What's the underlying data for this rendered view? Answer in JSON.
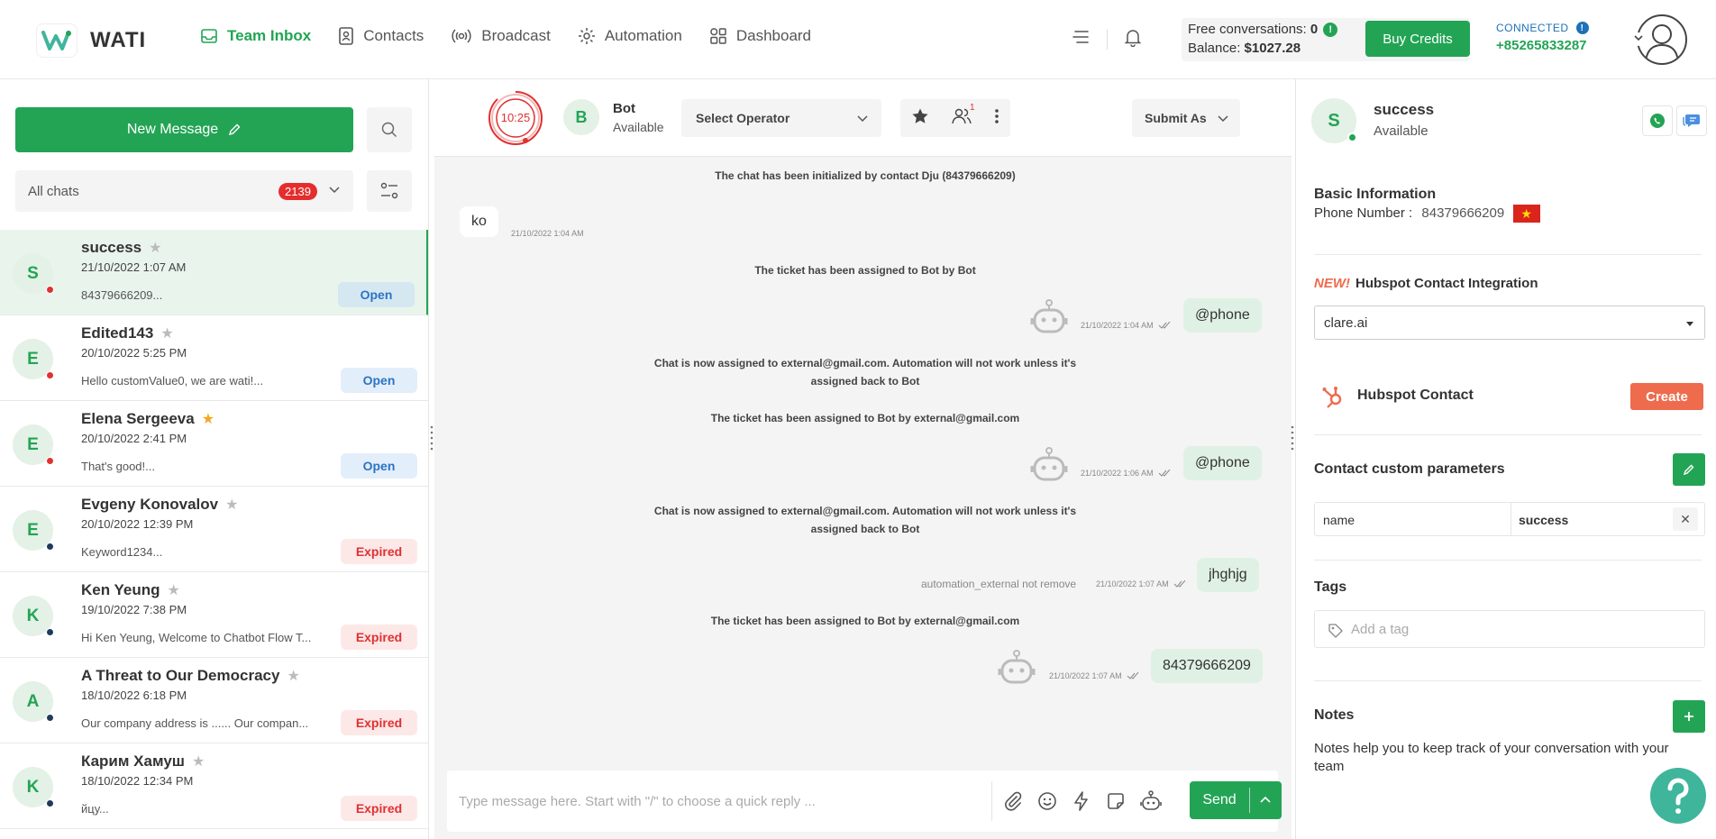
{
  "brand": {
    "name": "WATI"
  },
  "nav": {
    "items": [
      {
        "label": "Team Inbox",
        "icon": "inbox-icon",
        "active": true
      },
      {
        "label": "Contacts",
        "icon": "contacts-icon"
      },
      {
        "label": "Broadcast",
        "icon": "broadcast-icon"
      },
      {
        "label": "Automation",
        "icon": "automation-icon"
      },
      {
        "label": "Dashboard",
        "icon": "dashboard-icon"
      }
    ]
  },
  "credits": {
    "free_label": "Free conversations:",
    "free_value": "0",
    "balance_label": "Balance:",
    "balance_value": "$1027.28",
    "buy_label": "Buy Credits",
    "connected_label": "CONNECTED",
    "phone": "+85265833287"
  },
  "left": {
    "new_message": "New Message",
    "filter_label": "All chats",
    "filter_count": "2139",
    "chats": [
      {
        "initial": "S",
        "name": "success",
        "date": "21/10/2022 1:07 AM",
        "preview": "84379666209...",
        "status": "Open",
        "dot": "#e03131",
        "starred": false,
        "active": true
      },
      {
        "initial": "E",
        "name": "Edited143",
        "date": "20/10/2022 5:25 PM",
        "preview": "Hello customValue0, we are wati!...",
        "status": "Open",
        "dot": "#e03131",
        "starred": false
      },
      {
        "initial": "E",
        "name": "Elena Sergeeva",
        "date": "20/10/2022 2:41 PM",
        "preview": "That's good!...",
        "status": "Open",
        "dot": "#e03131",
        "starred": true
      },
      {
        "initial": "E",
        "name": "Evgeny Konovalov",
        "date": "20/10/2022 12:39 PM",
        "preview": "Keyword1234...",
        "status": "Expired",
        "dot": "#1f3b5c",
        "starred": false
      },
      {
        "initial": "K",
        "name": "Ken Yeung",
        "date": "19/10/2022 7:38 PM",
        "preview": "Hi Ken Yeung, Welcome to Chatbot Flow T...",
        "status": "Expired",
        "dot": "#1f3b5c",
        "starred": false
      },
      {
        "initial": "A",
        "name": "A Threat to Our Democracy",
        "date": "18/10/2022 6:18 PM",
        "preview": "Our company address is ...... Our compan...",
        "status": "Expired",
        "dot": "#1f3b5c",
        "starred": false
      },
      {
        "initial": "K",
        "name": "Карим Хамуш",
        "date": "18/10/2022 12:34 PM",
        "preview": "йцу...",
        "status": "Expired",
        "dot": "#1f3b5c",
        "starred": false
      }
    ]
  },
  "chat": {
    "timer": "10:25",
    "assignee_initial": "B",
    "assignee_name": "Bot",
    "assignee_status": "Available",
    "operator_placeholder": "Select Operator",
    "team_count": "1",
    "submit_as": "Submit As",
    "messages": {
      "sys1": "The chat has been initialized by contact Dju (84379666209)",
      "in1": "ko",
      "in1_time": "21/10/2022 1:04 AM",
      "sys2": "The ticket has been assigned to Bot by Bot",
      "out1": "@phone",
      "out1_time": "21/10/2022 1:04 AM",
      "sys3a": "Chat is now assigned to external@gmail.com. Automation will not work unless it's",
      "sys3b": "assigned back to Bot",
      "sys4": "The ticket has been assigned to Bot by external@gmail.com",
      "out2": "@phone",
      "out2_time": "21/10/2022 1:06 AM",
      "sys5a": "Chat is now assigned to external@gmail.com. Automation will not work unless it's",
      "sys5b": "assigned back to Bot",
      "out3": "jhghjg",
      "out3_note": "automation_external not remove",
      "out3_time": "21/10/2022 1:07 AM",
      "sys6": "The ticket has been assigned to Bot by external@gmail.com",
      "out4": "84379666209",
      "out4_time": "21/10/2022 1:07 AM"
    },
    "composer_placeholder": "Type message here. Start with \"/\" to choose a quick reply ...",
    "send_label": "Send"
  },
  "contact": {
    "initial": "S",
    "name": "success",
    "status": "Available",
    "basic_title": "Basic Information",
    "phone_label": "Phone Number :",
    "phone_value": "84379666209",
    "hubspot_new": "NEW!",
    "hubspot_title": "Hubspot Contact Integration",
    "hubspot_selected": "clare.ai",
    "hubspot_contact": "Hubspot Contact",
    "create_label": "Create",
    "params_title": "Contact custom parameters",
    "param_key": "name",
    "param_value": "success",
    "tags_title": "Tags",
    "tags_placeholder": "Add a tag",
    "notes_title": "Notes",
    "notes_text": "Notes help you to keep track of your conversation with your team"
  },
  "colors": {
    "brand": "#23a455",
    "danger": "#e03131",
    "hubspot": "#ee6b4d"
  }
}
